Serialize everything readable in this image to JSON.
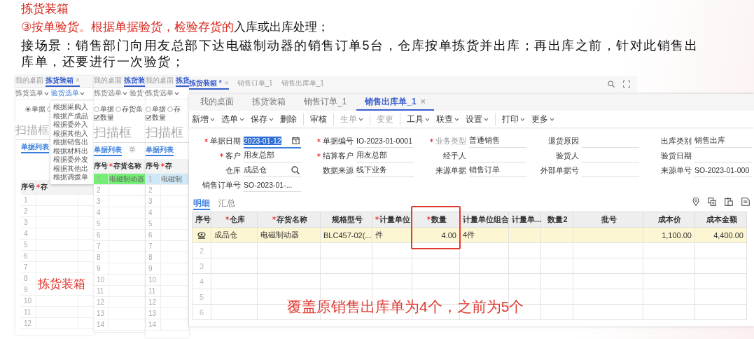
{
  "heading": {
    "title": "拣货装箱",
    "point": [
      {
        "text": "③按单验货。根据单据验货，检验存货的",
        "emphasis": true
      },
      {
        "text": "入库或出库处理；",
        "emphasis": false
      }
    ],
    "paragraph": "接场景：销售部门向用友总部下达电磁制动器的销售订单5台，仓库按单拣货并出库；再出库之前，针对此销售出库单，还要进行一次验货；"
  },
  "picking_windows": [
    {
      "tabs": [
        {
          "label": "我的桌面",
          "selected": false,
          "closable": false
        },
        {
          "label": "拣货装箱",
          "selected": true,
          "closable": true
        }
      ],
      "close_label": "×",
      "toolbar": [
        {
          "label": "拣货选单",
          "expanded": false
        },
        {
          "label": "验货选单",
          "expanded": true
        }
      ],
      "menu": [
        "根据采购入",
        "根据产成品",
        "根据委外入",
        "根据其他入",
        "根据销售出",
        "根据材料出",
        "根据委外发",
        "根据其他出",
        "根据调拨单"
      ],
      "options": [
        {
          "kind": "radio",
          "label": "单据",
          "checked": true
        },
        {
          "kind": "radio",
          "checked": false
        }
      ],
      "scan_placeholder": "扫描框",
      "list_tabs": [
        {
          "label": "单据列表",
          "selected": true
        }
      ],
      "columns": [
        {
          "label": "序号",
          "required": false
        },
        {
          "label": "存",
          "required": true
        }
      ],
      "rows": [
        {
          "cells": [
            "1"
          ]
        },
        {
          "cells": [
            "2"
          ]
        },
        {
          "cells": [
            "3"
          ]
        },
        {
          "cells": [
            "4"
          ]
        },
        {
          "cells": [
            "5"
          ]
        },
        {
          "cells": [
            "6"
          ]
        },
        {
          "cells": [
            "7"
          ]
        },
        {
          "cells": [
            "8"
          ]
        },
        {
          "cells": [
            "9"
          ]
        },
        {
          "cells": [
            "10"
          ]
        },
        {
          "cells": [
            "11"
          ]
        },
        {
          "cells": [
            "12"
          ]
        }
      ],
      "overlay_label": "拣货装箱"
    },
    {
      "tabs": [
        {
          "label": "我的桌面",
          "selected": false
        },
        {
          "label": "拣货装",
          "selected": true
        }
      ],
      "toolbar": [
        {
          "label": "拣货选单",
          "expanded": false
        },
        {
          "label": "验货",
          "expanded": false
        }
      ],
      "options": [
        {
          "kind": "radio",
          "label": "单据",
          "checked": false
        },
        {
          "kind": "radio",
          "label": "存货条",
          "checked": false
        },
        {
          "kind": "checkbox",
          "label": "数量",
          "checked": true
        }
      ],
      "scan_placeholder": "扫描框",
      "list_tabs": [
        {
          "label": "单据列表",
          "selected": true
        },
        {
          "label": "单",
          "selected": false
        }
      ],
      "columns": [
        {
          "label": "序号",
          "required": false
        },
        {
          "label": "存货名称",
          "required": true
        }
      ],
      "rows": [
        {
          "cells": [
            "1",
            "电磁制动器"
          ],
          "color": "#74ee74"
        },
        {
          "cells": [
            "2"
          ]
        },
        {
          "cells": [
            "3"
          ]
        },
        {
          "cells": [
            "4"
          ]
        },
        {
          "cells": [
            "5"
          ]
        },
        {
          "cells": [
            "6"
          ]
        },
        {
          "cells": [
            "7"
          ]
        },
        {
          "cells": [
            "8"
          ]
        },
        {
          "cells": [
            "9"
          ]
        },
        {
          "cells": [
            "10"
          ]
        },
        {
          "cells": [
            "11"
          ]
        },
        {
          "cells": [
            "12"
          ]
        },
        {
          "cells": [
            "13"
          ]
        },
        {
          "cells": [
            "14"
          ]
        }
      ]
    },
    {
      "tabs": [
        {
          "label": "我的桌面",
          "selected": false
        },
        {
          "label": "拣货",
          "selected": true
        }
      ],
      "toolbar": [
        {
          "label": "拣货选单",
          "expanded": false
        }
      ],
      "options": [
        {
          "kind": "radio",
          "label": "单据",
          "checked": false
        },
        {
          "kind": "radio",
          "label": "存",
          "checked": false
        },
        {
          "kind": "checkbox",
          "label": "数量",
          "checked": true
        }
      ],
      "scan_placeholder": "扫描框",
      "list_tabs": [
        {
          "label": "单据列表",
          "selected": true
        }
      ],
      "columns": [
        {
          "label": "序号",
          "required": false
        },
        {
          "label": "存",
          "required": true
        }
      ],
      "rows": [
        {
          "cells": [
            "1",
            "电磁制"
          ],
          "color": "#cfe8f7"
        },
        {
          "cells": [
            "2"
          ]
        },
        {
          "cells": [
            "3"
          ]
        },
        {
          "cells": [
            "4"
          ]
        },
        {
          "cells": [
            "5"
          ]
        },
        {
          "cells": [
            "6"
          ]
        },
        {
          "cells": [
            "7"
          ]
        },
        {
          "cells": [
            "8"
          ]
        },
        {
          "cells": [
            "9"
          ]
        },
        {
          "cells": [
            "10"
          ]
        },
        {
          "cells": [
            "11"
          ]
        },
        {
          "cells": [
            "12"
          ]
        },
        {
          "cells": [
            "13"
          ]
        },
        {
          "cells": [
            "14"
          ]
        }
      ]
    }
  ],
  "back_tabs": [
    {
      "label": "拣货装箱 *",
      "selected": true,
      "closable": true
    },
    {
      "label": "销售订单_1",
      "selected": false,
      "closable": false
    },
    {
      "label": "销售出库单_1",
      "selected": false,
      "closable": false
    }
  ],
  "sales_outbound": {
    "close_label": "×",
    "tabs": [
      {
        "label": "我的桌面",
        "selected": false,
        "closable": false
      },
      {
        "label": "拣货装箱",
        "selected": false,
        "closable": false
      },
      {
        "label": "销售订单_1",
        "selected": false,
        "closable": false
      },
      {
        "label": "销售出库单_1",
        "selected": true,
        "closable": true
      }
    ],
    "toolbar": [
      {
        "label": "新增",
        "dropdown": true,
        "disabled": false,
        "divider_after": false
      },
      {
        "label": "选单",
        "dropdown": true,
        "disabled": false,
        "divider_after": false
      },
      {
        "label": "保存",
        "dropdown": true,
        "disabled": false,
        "divider_after": false
      },
      {
        "label": "删除",
        "dropdown": false,
        "disabled": false,
        "divider_after": true
      },
      {
        "label": "审核",
        "dropdown": false,
        "disabled": false,
        "divider_after": true
      },
      {
        "label": "生单",
        "dropdown": true,
        "disabled": true,
        "divider_after": true
      },
      {
        "label": "变更",
        "dropdown": false,
        "disabled": true,
        "divider_after": true
      },
      {
        "label": "工具",
        "dropdown": true,
        "disabled": false,
        "divider_after": false
      },
      {
        "label": "联查",
        "dropdown": true,
        "disabled": false,
        "divider_after": false
      },
      {
        "label": "设置",
        "dropdown": true,
        "disabled": false,
        "divider_after": true
      },
      {
        "label": "打印",
        "dropdown": true,
        "disabled": false,
        "divider_after": false
      },
      {
        "label": "更多",
        "dropdown": true,
        "disabled": false,
        "divider_after": false
      }
    ],
    "form": [
      {
        "label": "单据日期",
        "required": true,
        "disabled": false,
        "highlighted": true,
        "value": "2023-01-12",
        "kind": "date"
      },
      {
        "label": "单据编号",
        "required": true,
        "disabled": false,
        "highlighted": false,
        "value": "IO-2023-01-0001",
        "kind": "text"
      },
      {
        "label": "业务类型",
        "required": true,
        "disabled": true,
        "highlighted": false,
        "value": "普通销售",
        "kind": "text"
      },
      {
        "label": "退货原因",
        "required": false,
        "disabled": false,
        "kind": "text"
      },
      {
        "label": "出库类别",
        "required": false,
        "disabled": false,
        "highlighted": false,
        "value": "销售出库",
        "kind": "text"
      },
      {
        "label": "客户",
        "required": true,
        "disabled": false,
        "highlighted": false,
        "value": "用友总部",
        "kind": "text"
      },
      {
        "label": "结算客户",
        "required": true,
        "disabled": false,
        "highlighted": false,
        "value": "用友总部",
        "kind": "text"
      },
      {
        "label": "经手人",
        "required": false,
        "disabled": false,
        "kind": "text"
      },
      {
        "label": "验货人",
        "required": false,
        "disabled": false,
        "kind": "text"
      },
      {
        "label": "验货日期",
        "required": false,
        "disabled": false,
        "kind": "text"
      },
      {
        "label": "仓库",
        "required": false,
        "disabled": false,
        "highlighted": false,
        "value": "成品仓",
        "kind": "lookup"
      },
      {
        "label": "数据来源",
        "required": false,
        "disabled": false,
        "highlighted": false,
        "value": "线下业务",
        "kind": "text"
      },
      {
        "label": "来源单据",
        "required": false,
        "disabled": false,
        "highlighted": false,
        "value": "销售订单",
        "kind": "text"
      },
      {
        "label": "外部单据号",
        "required": false,
        "disabled": false,
        "kind": "text"
      },
      {
        "label": "来源单号",
        "required": false,
        "disabled": false,
        "highlighted": false,
        "value": "SO-2023-01-000",
        "kind": "text"
      },
      {
        "label": "销售订单号",
        "required": false,
        "disabled": false,
        "highlighted": false,
        "value": "SO-2023-01-...",
        "kind": "text"
      }
    ],
    "detail_tabs": [
      {
        "label": "明细",
        "selected": true
      },
      {
        "label": "汇总",
        "selected": false
      }
    ],
    "columns": [
      {
        "label": "序号",
        "required": false,
        "kind": "index",
        "boxed": false
      },
      {
        "label": "仓库",
        "required": true,
        "kind": "text",
        "boxed": false
      },
      {
        "label": "存货名称",
        "required": true,
        "kind": "text",
        "boxed": false
      },
      {
        "label": "规格型号",
        "required": false,
        "kind": "text",
        "boxed": false
      },
      {
        "label": "计量单位",
        "required": true,
        "kind": "text",
        "boxed": false
      },
      {
        "label": "数量",
        "required": true,
        "kind": "number",
        "boxed": true
      },
      {
        "label": "计量单位组合",
        "required": false,
        "kind": "text",
        "boxed": false
      },
      {
        "label": "计量单...",
        "required": false,
        "kind": "text",
        "boxed": false
      },
      {
        "label": "数量2",
        "required": false,
        "kind": "text",
        "boxed": false
      },
      {
        "label": "批号",
        "required": false,
        "kind": "text",
        "boxed": false
      },
      {
        "label": "成本价",
        "required": false,
        "kind": "number",
        "boxed": false
      },
      {
        "label": "成本金额",
        "required": false,
        "kind": "number",
        "boxed": false
      }
    ],
    "rows": [
      {
        "current": true,
        "cells": [
          "",
          "成品仓",
          "电磁制动器",
          "BLC457-02(...",
          "件",
          "4.00",
          "4件",
          "",
          "",
          "",
          "1,100.00",
          "4,400.00"
        ]
      },
      {
        "current": false,
        "cells": [
          "2"
        ]
      },
      {
        "current": false,
        "cells": [
          "3"
        ]
      },
      {
        "current": false,
        "cells": [
          "4"
        ]
      },
      {
        "current": false,
        "cells": [
          "5"
        ]
      },
      {
        "current": false,
        "cells": [
          "6"
        ]
      }
    ],
    "caption": "覆盖原销售出库单为4个，之前为5个"
  }
}
